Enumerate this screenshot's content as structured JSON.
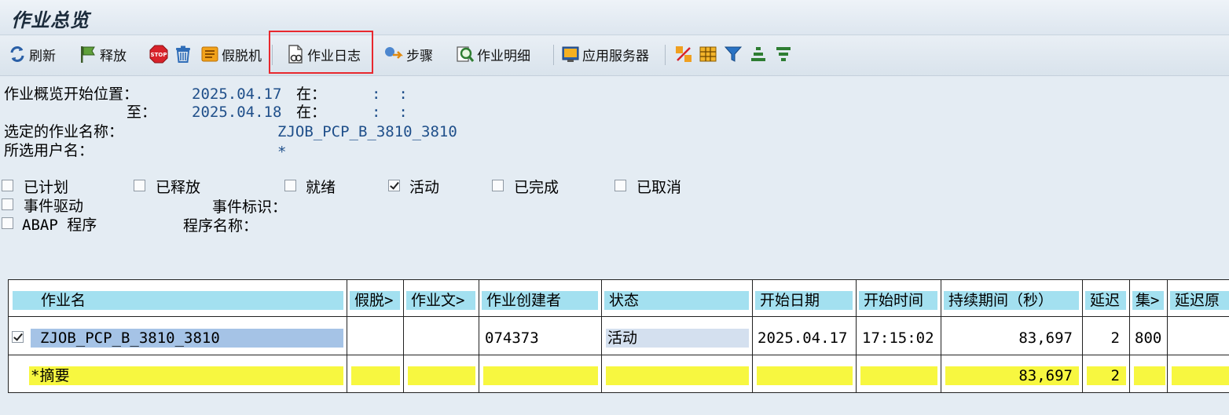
{
  "window": {
    "title": "作业总览"
  },
  "toolbar": {
    "refresh": "刷新",
    "release": "释放",
    "spool": "假脱机",
    "job_log": "作业日志",
    "steps": "步骤",
    "job_details": "作业明细",
    "app_server": "应用服务器"
  },
  "criteria": {
    "start_label": "作业概览开始位置：",
    "start_date": "2025.04.17",
    "at1": "在：",
    "time1": ":  :",
    "to_label": "至：",
    "end_date": "2025.04.18",
    "at2": "在：",
    "time2": ":  :",
    "job_name_label": "选定的作业名称：",
    "job_name": "ZJOB_PCP_B_3810_3810",
    "user_label": "所选用户名：",
    "user": "*"
  },
  "status_filters": {
    "scheduled": {
      "label": "已计划",
      "checked": false
    },
    "released": {
      "label": "已释放",
      "checked": false
    },
    "ready": {
      "label": "就绪",
      "checked": false
    },
    "active": {
      "label": "活动",
      "checked": true
    },
    "finished": {
      "label": "已完成",
      "checked": false
    },
    "cancelled": {
      "label": "已取消",
      "checked": false
    },
    "event_driven": {
      "label": "事件驱动",
      "checked": false
    },
    "event_id_label": "事件标识：",
    "abap_program": {
      "label": "ABAP 程序",
      "checked": false
    },
    "program_name_label": "程序名称："
  },
  "table": {
    "columns": [
      "作业名",
      "假脱>",
      "作业文>",
      "作业创建者",
      "状态",
      "开始日期",
      "开始时间",
      "持续期间（秒）",
      "延迟",
      "集>",
      "延迟原"
    ],
    "rows": [
      {
        "checked": true,
        "job_name": "ZJOB_PCP_B_3810_3810",
        "spool": "",
        "job_doc": "",
        "created_by": "074373",
        "status": "活动",
        "start_date": "2025.04.17",
        "start_time": "17:15:02",
        "duration": "83,697",
        "delay": "2",
        "client": "800",
        "delay_reason": ""
      }
    ],
    "summary": {
      "label": "*摘要",
      "duration": "83,697",
      "delay": "2"
    }
  }
}
